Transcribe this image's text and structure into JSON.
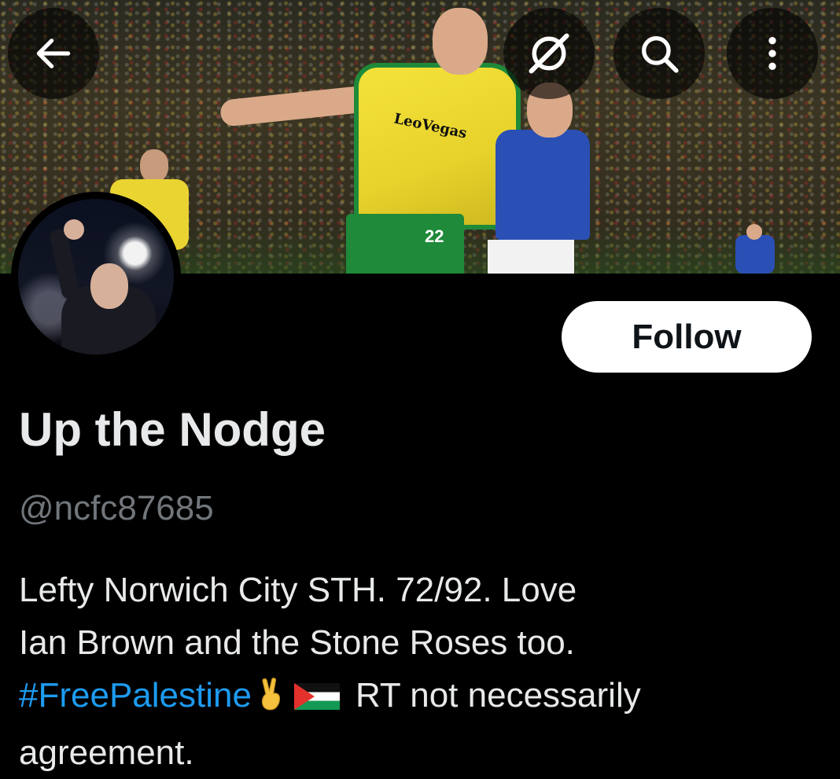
{
  "header": {
    "back_icon": "arrow-left-icon",
    "grok_icon": "grok-icon",
    "search_icon": "search-icon",
    "more_icon": "more-vertical-icon",
    "banner_sponsor_text": "LeoVegas",
    "banner_shirt_number": "22"
  },
  "profile": {
    "display_name": "Up the Nodge",
    "handle": "@ncfc87685",
    "follow_label": "Follow",
    "bio": {
      "line1": "Lefty Norwich City STH. 72/92.  Love",
      "line2": "Ian Brown and the Stone Roses too.",
      "hashtag": "#FreePalestine",
      "line3_rest": "RT not necessarily",
      "line4": "agreement."
    }
  },
  "colors": {
    "background": "#000000",
    "text_primary": "#e7e9ea",
    "text_secondary": "#71767b",
    "link": "#1d9bf0",
    "button_bg": "#ffffff",
    "button_text": "#0f1419"
  }
}
